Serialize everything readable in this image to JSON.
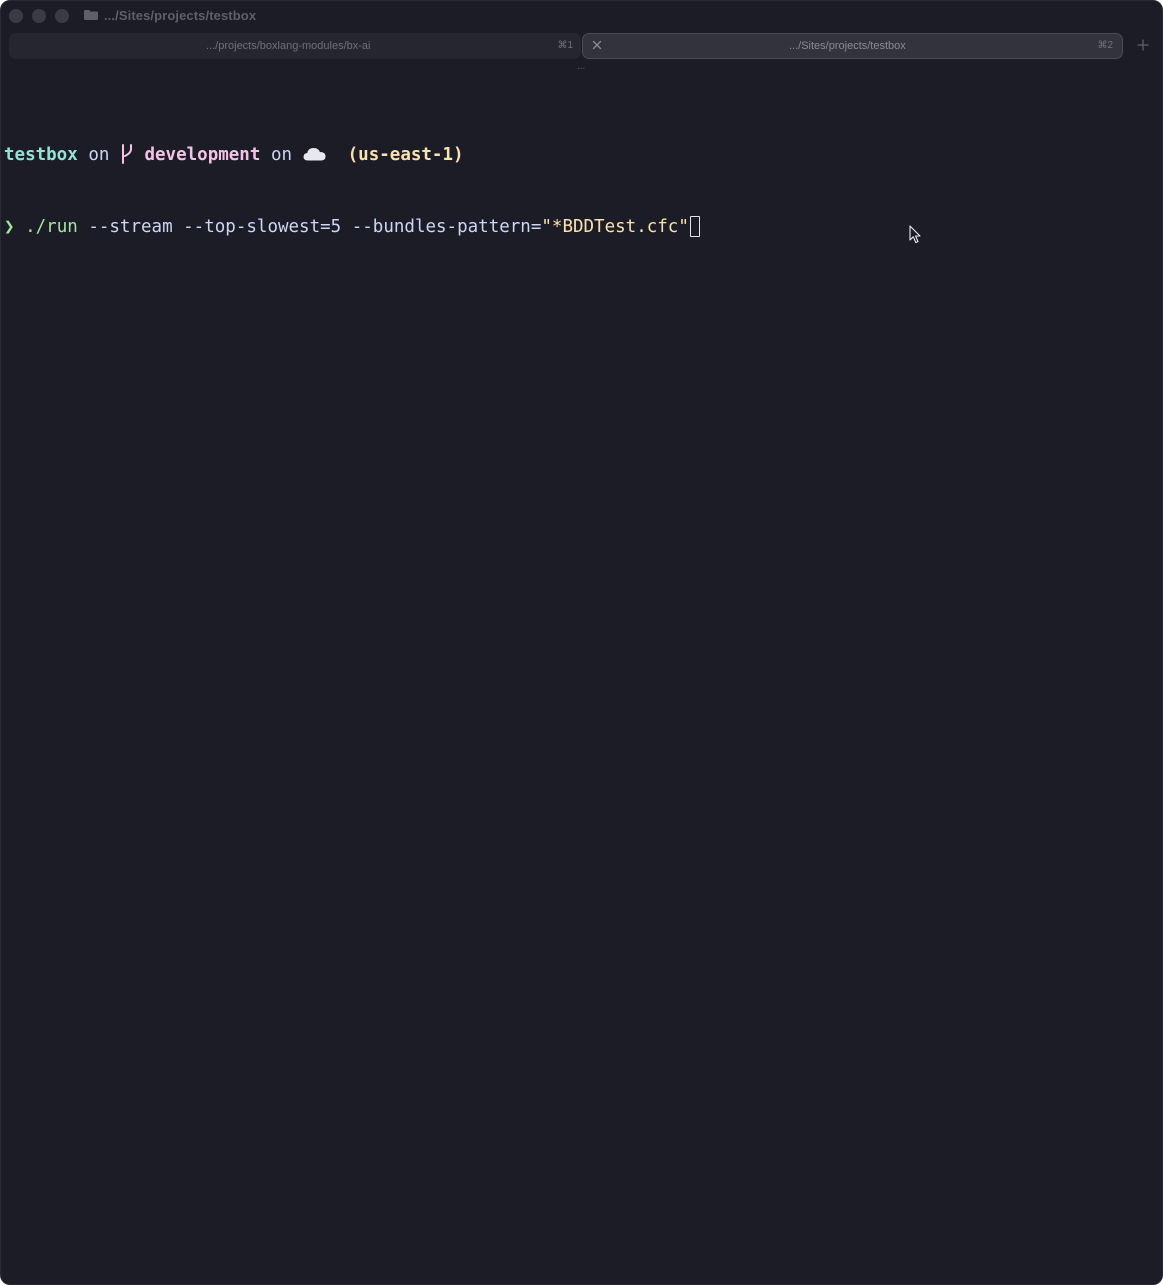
{
  "window": {
    "title": ".../Sites/projects/testbox",
    "background": "#1c1c27"
  },
  "tabs": [
    {
      "label": ".../projects/boxlang-modules/bx-ai",
      "shortcut": "⌘1",
      "active": false
    },
    {
      "label": ".../Sites/projects/testbox",
      "shortcut": "⌘2",
      "active": true
    }
  ],
  "tabbar": {
    "overflow_indicator": "...",
    "new_tab_icon": "plus-icon",
    "close_tab_icon": "close-icon"
  },
  "terminal": {
    "prompt": {
      "directory": "testbox",
      "on_1": "on",
      "branch_icon": "git-branch-icon",
      "branch": "development",
      "on_2": "on",
      "cloud_icon": "cloud-icon",
      "region": "(us-east-1)"
    },
    "command": {
      "prompt_char": "❯",
      "program": "./run",
      "args": "--stream --top-slowest=5 --bundles-pattern=",
      "quoted_arg": "\"*BDDTest.cfc\""
    }
  },
  "colors": {
    "directory": "#94e2d5",
    "branch": "#f5c2e7",
    "region": "#f9e2af",
    "prompt": "#a6e3a1",
    "text": "#cdd6f4"
  }
}
